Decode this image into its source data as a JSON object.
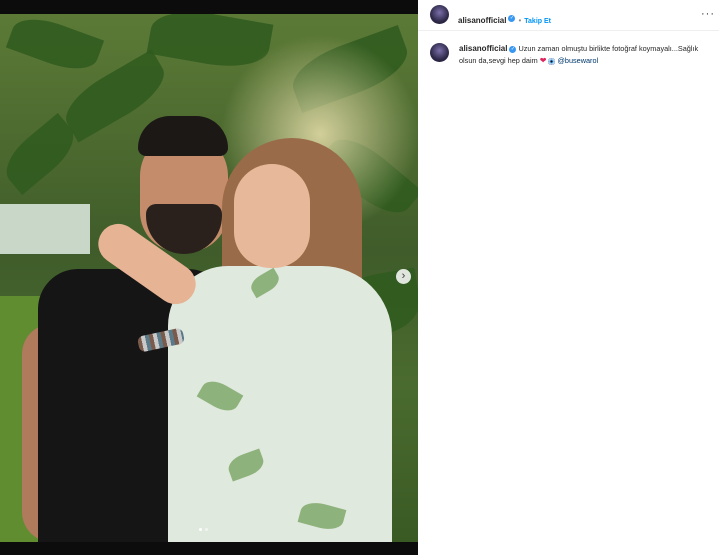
{
  "post": {
    "username": "alisanofficial",
    "follow_label": "Takip Et",
    "separator": "•",
    "more_label": "···",
    "caption_text": "Uzun zaman olmuştu birlikte fotoğraf koymayalı...Sağlık olsun da,sevgi hep daim",
    "caption_mention": "@busewarol",
    "heart_glyph": "❤",
    "next_arrow": "›",
    "carousel_dots": 2,
    "carousel_active_index": 0
  },
  "colors": {
    "follow_blue": "#0095f6",
    "verified_blue": "#3897f0",
    "heart_red": "#e0245e",
    "mention_navy": "#00376b"
  }
}
